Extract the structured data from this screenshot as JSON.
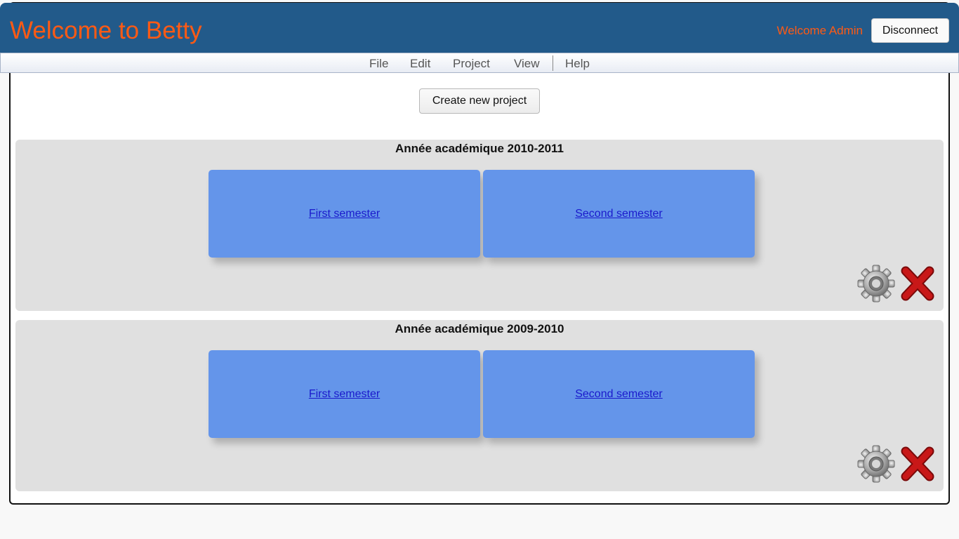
{
  "header": {
    "title": "Welcome to Betty",
    "welcome_text": "Welcome Admin",
    "disconnect_label": "Disconnect"
  },
  "menu": {
    "items": [
      "File",
      "Edit",
      "Project",
      "View",
      "Help"
    ]
  },
  "actions": {
    "create_project_label": "Create new project"
  },
  "academic_years": [
    {
      "title": "Année académique 2010-2011",
      "semesters": [
        "First semester",
        "Second semester"
      ]
    },
    {
      "title": "Année académique 2009-2010",
      "semesters": [
        "First semester",
        "Second semester"
      ]
    }
  ],
  "icons": [
    "gear-icon",
    "delete-icon"
  ],
  "colors": {
    "header_bg": "#225a8a",
    "title_accent": "#ff5a14",
    "card_bg": "#6495ea",
    "panel_bg": "#e0e0e0"
  }
}
